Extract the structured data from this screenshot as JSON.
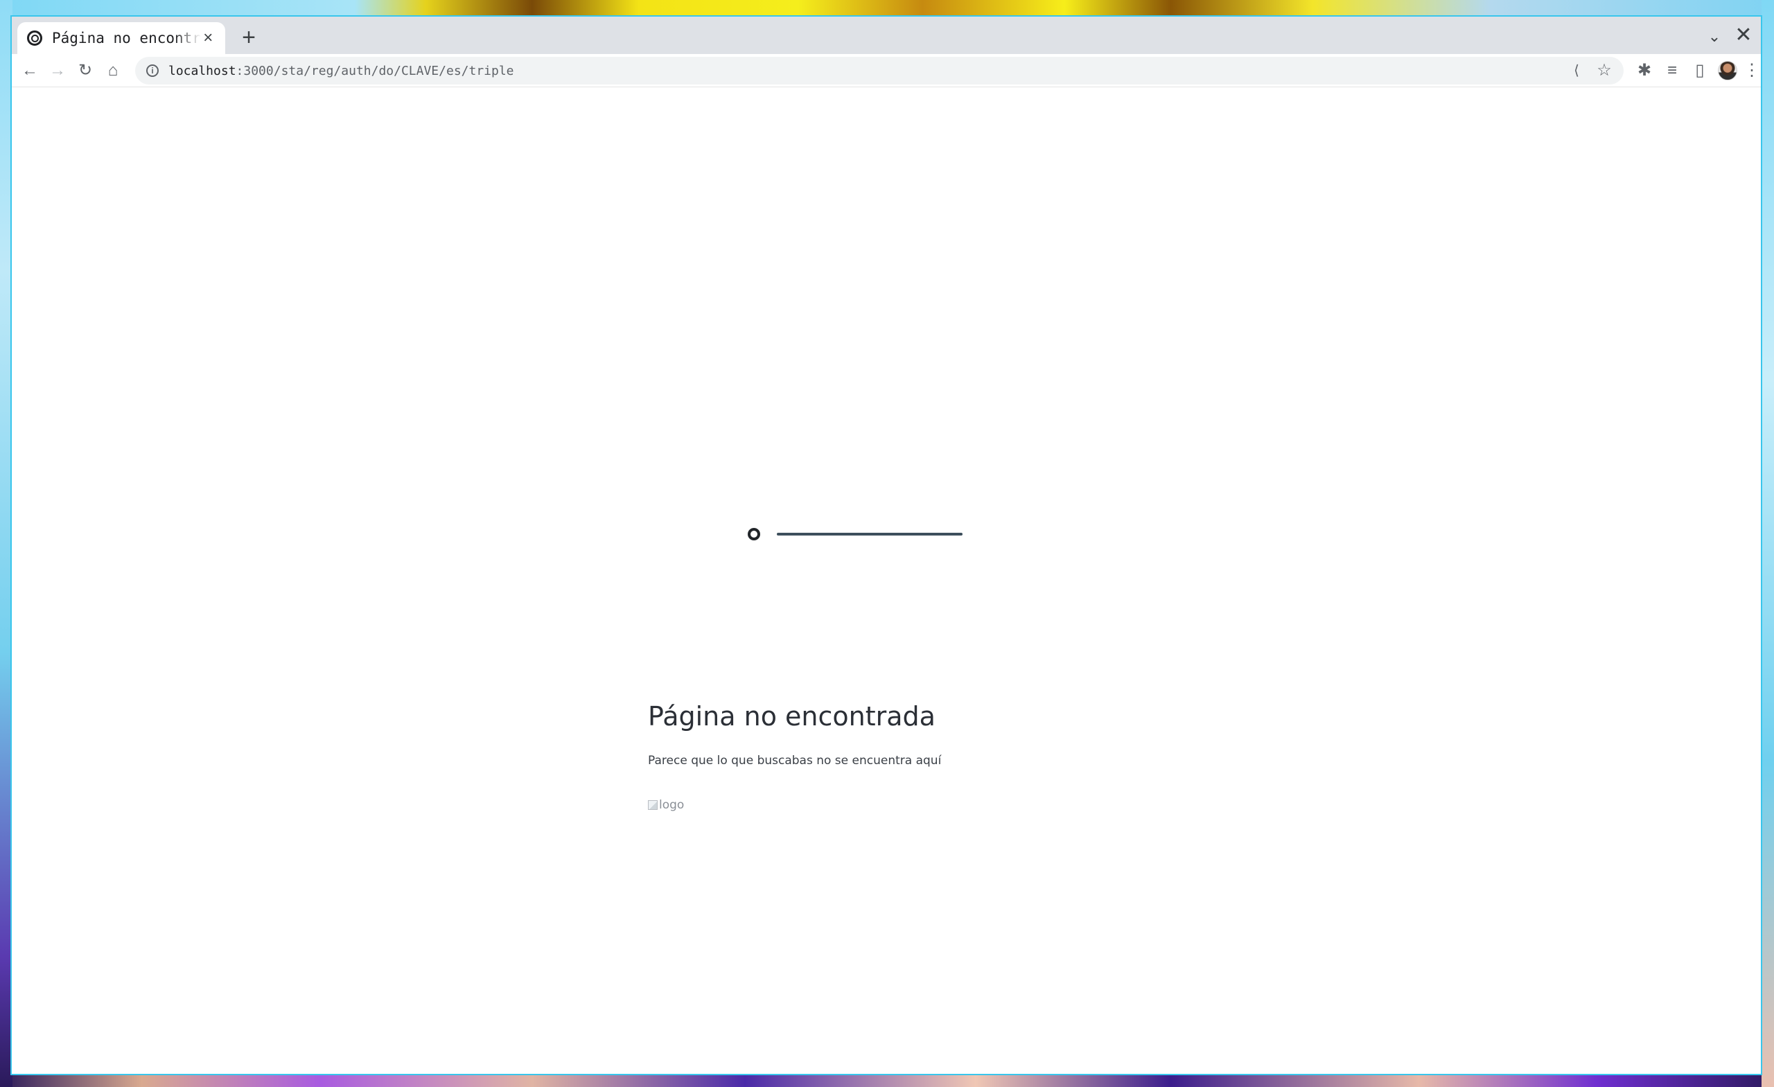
{
  "browser": {
    "tab": {
      "title": "Página no encontrada",
      "close_glyph": "×",
      "favicon": "target-icon"
    },
    "new_tab_glyph": "+",
    "tab_search_glyph": "⌄",
    "window_close_glyph": "✕",
    "toolbar": {
      "back_glyph": "←",
      "forward_glyph": "→",
      "reload_glyph": "↻",
      "home_glyph": "⌂"
    },
    "address_bar": {
      "host": "localhost",
      "path": ":3000/sta/reg/auth/do/CLAVE/es/triple",
      "info_glyph": "i",
      "share_glyph": "⟨",
      "bookmark_glyph": "☆"
    },
    "actions": {
      "extensions_glyph": "✱",
      "media_glyph": "≡",
      "side_panel_glyph": "▯",
      "menu_glyph": "⋮"
    }
  },
  "page": {
    "title": "Página no encontrada",
    "message": "Parece que lo que buscabas no se encuentra aquí",
    "logo_alt": "logo"
  }
}
